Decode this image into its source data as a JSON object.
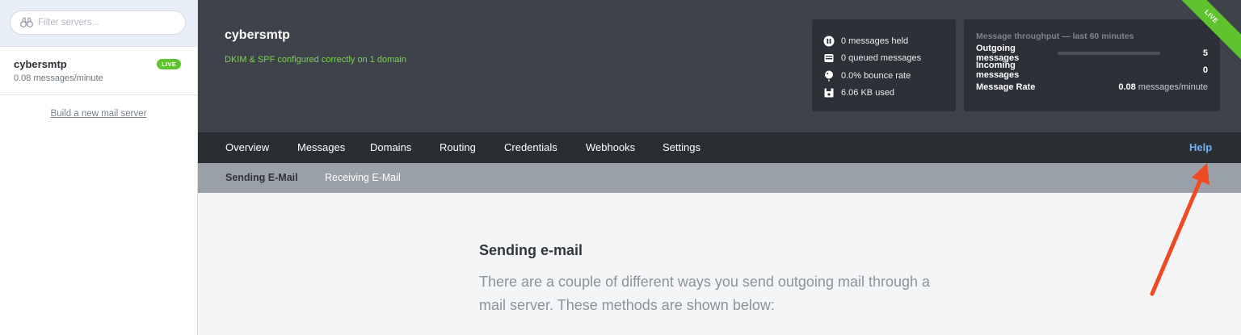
{
  "sidebar": {
    "filter_placeholder": "Filter servers...",
    "server": {
      "name": "cybersmtp",
      "rate": "0.08 messages/minute",
      "badge": "LIVE"
    },
    "build_link": "Build a new mail server"
  },
  "header": {
    "title": "cybersmtp",
    "subtitle": "DKIM & SPF configured correctly on 1 domain",
    "live_ribbon": "LIVE",
    "stats": [
      {
        "icon": "pause-icon",
        "text": "0 messages held"
      },
      {
        "icon": "inbox-tray-icon",
        "text": "0 queued messages"
      },
      {
        "icon": "balloon-icon",
        "text": "0.0% bounce rate"
      },
      {
        "icon": "floppy-disk-icon",
        "text": "6.06 KB used"
      }
    ],
    "throughput": {
      "heading": "Message throughput — last 60 minutes",
      "outgoing_label": "Outgoing messages",
      "outgoing_value": "5",
      "incoming_label": "Incoming messages",
      "incoming_value": "0",
      "rate_label": "Message Rate",
      "rate_value": "0.08",
      "rate_unit": "messages/minute"
    }
  },
  "main_nav": {
    "items": [
      "Overview",
      "Messages",
      "Domains",
      "Routing",
      "Credentials",
      "Webhooks",
      "Settings"
    ],
    "help": "Help"
  },
  "sub_nav": {
    "items": [
      "Sending E-Mail",
      "Receiving E-Mail"
    ]
  },
  "content": {
    "title": "Sending e-mail",
    "body": "There are a couple of different ways you send outgoing mail through a mail server. These methods are shown below:"
  },
  "colors": {
    "header_bg": "#3e434b",
    "nav_bg": "#2a2d32",
    "subnav_bg": "#9aa0a8",
    "live_green": "#5fc32d",
    "help_blue": "#6fb0f2",
    "annotation_arrow": "#f04a23"
  }
}
